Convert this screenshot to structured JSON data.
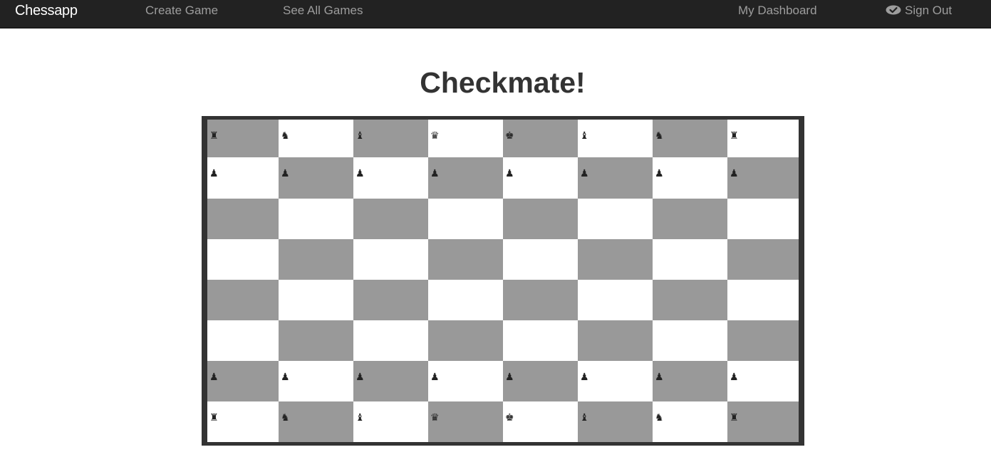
{
  "nav": {
    "brand": "Chessapp",
    "create_game": "Create Game",
    "see_all_games": "See All Games",
    "my_dashboard": "My Dashboard",
    "sign_out": "Sign Out",
    "sign_out_icon": "check-badge-icon"
  },
  "status_title": "Checkmate!",
  "board": {
    "light_color": "#ffffff",
    "dark_color": "#999999",
    "frame_color": "#333333",
    "squares": [
      [
        {
          "name": "rook",
          "glyph": "♜"
        },
        {
          "name": "knight",
          "glyph": "♞"
        },
        {
          "name": "bishop",
          "glyph": "♝"
        },
        {
          "name": "queen",
          "glyph": "♛"
        },
        {
          "name": "king",
          "glyph": "♚"
        },
        {
          "name": "bishop",
          "glyph": "♝"
        },
        {
          "name": "knight",
          "glyph": "♞"
        },
        {
          "name": "rook",
          "glyph": "♜"
        }
      ],
      [
        {
          "name": "pawn",
          "glyph": "♟"
        },
        {
          "name": "pawn",
          "glyph": "♟"
        },
        {
          "name": "pawn",
          "glyph": "♟"
        },
        {
          "name": "pawn",
          "glyph": "♟"
        },
        {
          "name": "pawn",
          "glyph": "♟"
        },
        {
          "name": "pawn",
          "glyph": "♟"
        },
        {
          "name": "pawn",
          "glyph": "♟"
        },
        {
          "name": "pawn",
          "glyph": "♟"
        }
      ],
      [
        null,
        null,
        null,
        null,
        null,
        null,
        null,
        null
      ],
      [
        null,
        null,
        null,
        null,
        null,
        null,
        null,
        null
      ],
      [
        null,
        null,
        null,
        null,
        null,
        null,
        null,
        null
      ],
      [
        null,
        null,
        null,
        null,
        null,
        null,
        null,
        null
      ],
      [
        {
          "name": "pawn",
          "glyph": "♟"
        },
        {
          "name": "pawn",
          "glyph": "♟"
        },
        {
          "name": "pawn",
          "glyph": "♟"
        },
        {
          "name": "pawn",
          "glyph": "♟"
        },
        {
          "name": "pawn",
          "glyph": "♟"
        },
        {
          "name": "pawn",
          "glyph": "♟"
        },
        {
          "name": "pawn",
          "glyph": "♟"
        },
        {
          "name": "pawn",
          "glyph": "♟"
        }
      ],
      [
        {
          "name": "rook",
          "glyph": "♜"
        },
        {
          "name": "knight",
          "glyph": "♞"
        },
        {
          "name": "bishop",
          "glyph": "♝"
        },
        {
          "name": "queen",
          "glyph": "♛"
        },
        {
          "name": "king",
          "glyph": "♚"
        },
        {
          "name": "bishop",
          "glyph": "♝"
        },
        {
          "name": "knight",
          "glyph": "♞"
        },
        {
          "name": "rook",
          "glyph": "♜"
        }
      ]
    ]
  }
}
